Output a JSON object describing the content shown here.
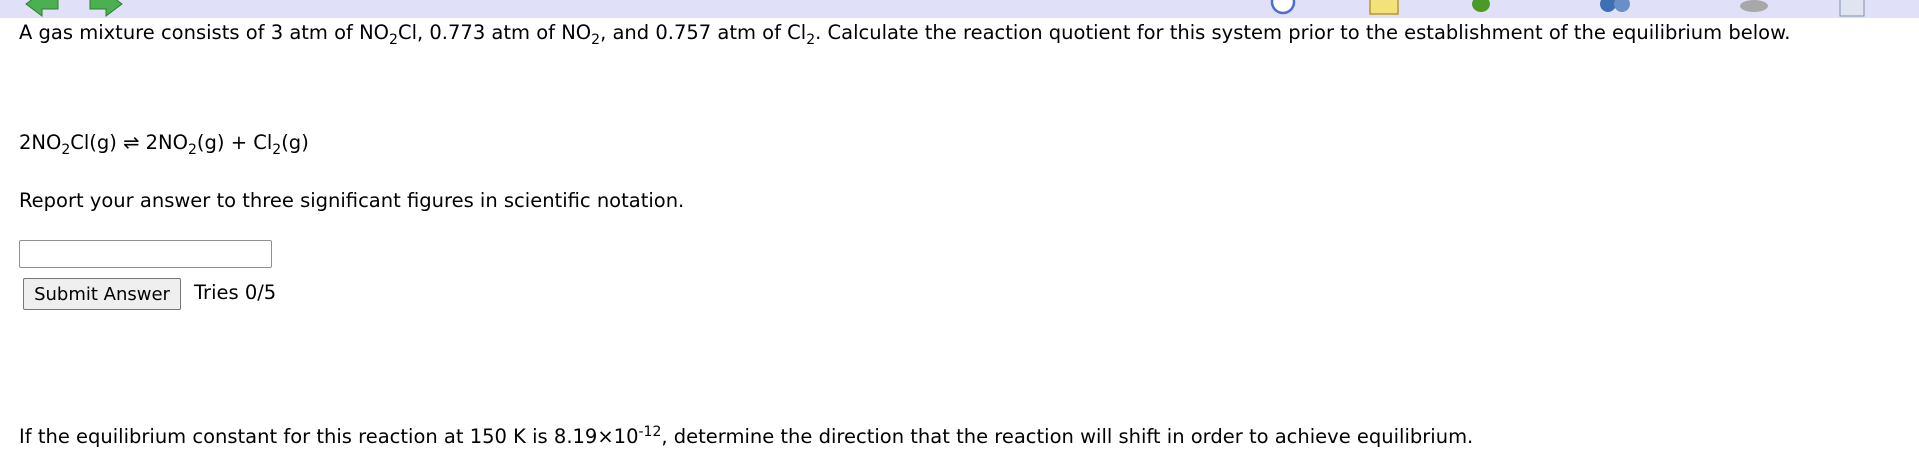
{
  "question": {
    "intro": {
      "t1": "A gas mixture consists of 3 atm of NO",
      "s1": "2",
      "t2": "Cl, 0.773 atm of NO",
      "s2": "2",
      "t3": ", and 0.757 atm of Cl",
      "s3": "2",
      "t4": ". Calculate the reaction quotient for this system prior to the establishment of the equilibrium below."
    },
    "equation": {
      "t1": "2NO",
      "s1": "2",
      "t2": "Cl(g) ⇌ 2NO",
      "s2": "2",
      "t3": "(g) + Cl",
      "s3": "2",
      "t4": "(g)"
    },
    "instruction": "Report your answer to three significant figures in scientific notation.",
    "answer_value": "",
    "submit_label": "Submit Answer",
    "tries": "Tries 0/5",
    "followup": {
      "t1": "If the equilibrium constant for this reaction at 150 K is 8.19×10",
      "sup": "-12",
      "t2": ", determine the direction that the reaction will shift in order to achieve equilibrium."
    }
  },
  "toolbar": {
    "icons": [
      "back-arrow-icon",
      "forward-arrow-icon",
      "clock-icon",
      "note-icon",
      "leaf-icon",
      "people-icon",
      "database-icon",
      "edit-icon"
    ],
    "colors": {
      "background": "#e0e0f8",
      "arrow": "#4caf50"
    }
  }
}
